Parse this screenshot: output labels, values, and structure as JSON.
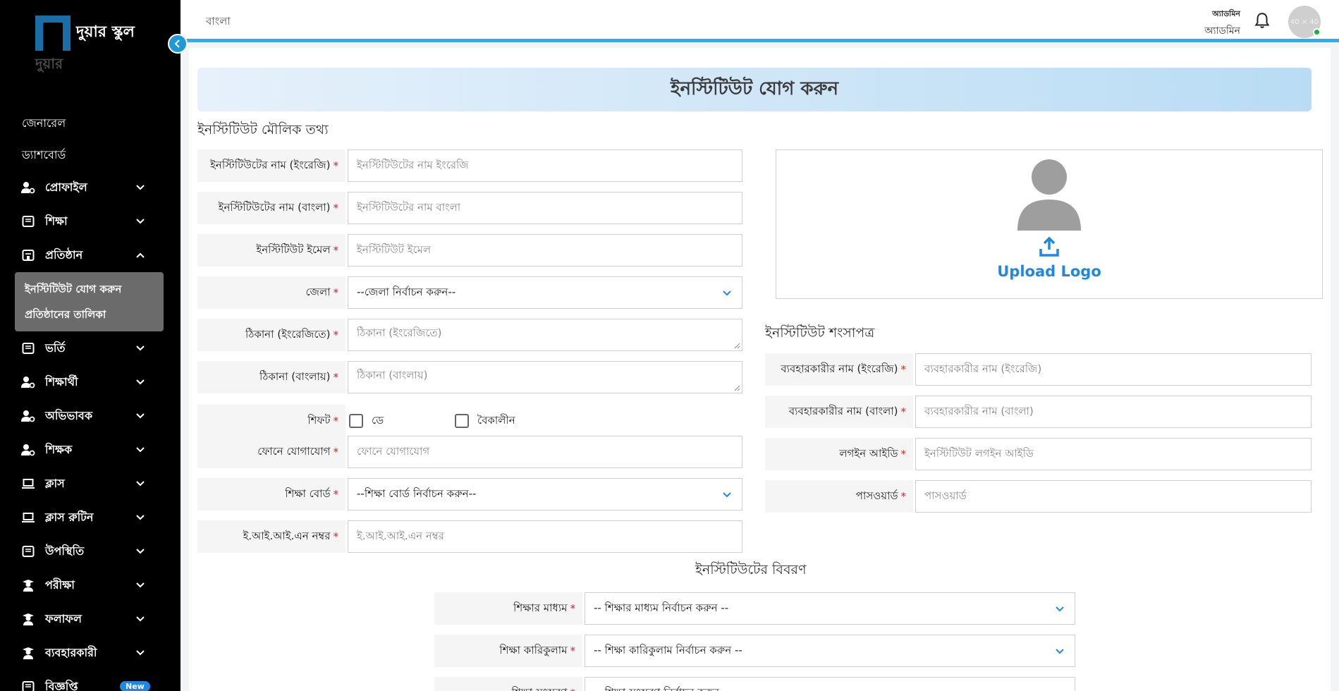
{
  "brand": {
    "title": "দুয়ার স্কুল",
    "subtitle": "দুয়ার"
  },
  "topbar": {
    "language": "বাংলা",
    "user_role": "অ্যাডমিন",
    "user_name": "অ্যাডমিন",
    "avatar_text": "40 × 40"
  },
  "sidebar": {
    "plain": [
      "জেনারেল",
      "ড্যাশবোর্ড"
    ],
    "items": [
      {
        "label": "প্রোফাইল",
        "icon": "user-gear-icon"
      },
      {
        "label": "শিক্ষা",
        "icon": "book-icon"
      },
      {
        "label": "প্রতিষ্ঠান",
        "icon": "building-icon"
      },
      {
        "label": "ভর্তি",
        "icon": "book-icon"
      },
      {
        "label": "শিক্ষার্থী",
        "icon": "user-gear-icon"
      },
      {
        "label": "অভিভাবক",
        "icon": "user-gear-icon"
      },
      {
        "label": "শিক্ষক",
        "icon": "user-gear-icon"
      },
      {
        "label": "ক্লাস",
        "icon": "laptop-icon"
      },
      {
        "label": "ক্লাস রুটিন",
        "icon": "laptop-icon"
      },
      {
        "label": "উপস্থিতি",
        "icon": "book-icon"
      },
      {
        "label": "পরীক্ষা",
        "icon": "graduate-icon"
      },
      {
        "label": "ফলাফল",
        "icon": "graduate-icon"
      },
      {
        "label": "ব্যবহারকারী",
        "icon": "graduate-icon"
      },
      {
        "label": "বিজ্ঞপ্তি",
        "icon": "book-icon",
        "badge": "New"
      }
    ],
    "submenu": [
      "ইনস্টিটিউট যোগ করুন",
      "প্রতিষ্ঠানের তালিকা"
    ]
  },
  "page": {
    "title": "ইনস্টিটিউট যোগ করুন",
    "section_basic": "ইনস্টিটিউট মৌলিক তথ্য",
    "section_credentials": "ইনস্টিটিউট শংসাপত্র",
    "section_details": "ইনস্টিটিউটের বিবরণ",
    "upload_logo": "Upload Logo"
  },
  "basic_fields": [
    {
      "label": "ইনস্টিটিউটের নাম (ইংরেজি)",
      "placeholder": "ইনস্টিটিউটের নাম ইংরেজি",
      "type": "input"
    },
    {
      "label": "ইনস্টিটিউটের নাম (বাংলা)",
      "placeholder": "ইনস্টিটিউটের নাম বাংলা",
      "type": "input"
    },
    {
      "label": "ইনস্টিটিউট ইমেল",
      "placeholder": "ইনস্টিটিউট ইমেল",
      "type": "input"
    },
    {
      "label": "জেলা",
      "placeholder": "--জেলা নির্বাচন করুন--",
      "type": "select"
    },
    {
      "label": "ঠিকানা (ইংরেজিতে)",
      "placeholder": "ঠিকানা (ইংরেজিতে)",
      "type": "textarea"
    },
    {
      "label": "ঠিকানা (বাংলায়)",
      "placeholder": "ঠিকানা (বাংলায়)",
      "type": "textarea"
    }
  ],
  "shift": {
    "label": "শিফট",
    "options": [
      "ডে",
      "বৈকালীন"
    ]
  },
  "basic_fields_2": [
    {
      "label": "ফোনে যোগাযোগ",
      "placeholder": "ফোনে যোগাযোগ",
      "type": "input"
    },
    {
      "label": "শিক্ষা বোর্ড",
      "placeholder": "--শিক্ষা বোর্ড নির্বাচন করুন--",
      "type": "select"
    },
    {
      "label": "ই.আই.আই.এন নম্বর",
      "placeholder": "ই.আই.আই.এন  নম্বর",
      "type": "input"
    }
  ],
  "credential_fields": [
    {
      "label": "ব্যবহারকারীর নাম (ইংরেজি)",
      "placeholder": "ব্যবহারকারীর নাম (ইংরেজি)"
    },
    {
      "label": "ব্যবহারকারীর নাম (বাংলা)",
      "placeholder": "ব্যবহারকারীর নাম (বাংলা)"
    },
    {
      "label": "লগইন আইডি",
      "placeholder": "ইনস্টিটিউট লগইন আইডি"
    },
    {
      "label": "পাসওয়ার্ড",
      "placeholder": "পাসওয়ার্ড"
    }
  ],
  "detail_fields": [
    {
      "label": "শিক্ষার মাধ্যম",
      "placeholder": "-- শিক্ষার মাধ্যম নির্বাচন করুন --"
    },
    {
      "label": "শিক্ষা কারিকুলাম",
      "placeholder": "-- শিক্ষা কারিকুলাম নির্বাচন করুন --"
    },
    {
      "label": "শিক্ষা সংস্করণ",
      "placeholder": "-- শিক্ষা সংস্করণ নির্বাচন করুন --"
    }
  ],
  "colors": {
    "accent": "#1e88e5",
    "topbar_border": "#29aef0",
    "required": "#e02020"
  }
}
